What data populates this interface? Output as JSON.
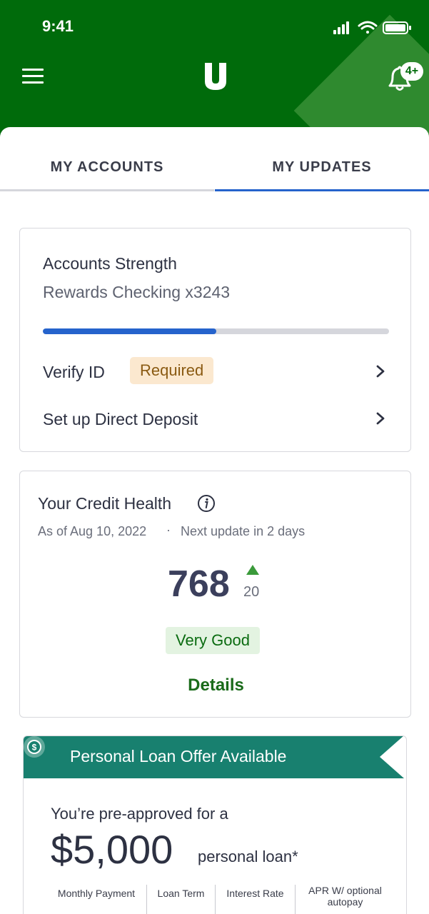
{
  "status_bar": {
    "time": "9:41"
  },
  "header": {
    "notification_badge": "4+"
  },
  "tabs": [
    {
      "label": "MY ACCOUNTS"
    },
    {
      "label": "MY UPDATES"
    }
  ],
  "accounts_strength": {
    "title": "Accounts Strength",
    "account": "Rewards Checking x3243",
    "progress_fraction": 0.5,
    "items": [
      {
        "label": "Verify ID",
        "badge": "Required"
      },
      {
        "label": "Set up Direct Deposit"
      }
    ]
  },
  "credit_health": {
    "title": "Your Credit Health",
    "as_of": "As of Aug 10, 2022",
    "separator": "·",
    "next_update": "Next update in 2 days",
    "score": "768",
    "change": "20",
    "rating": "Very Good",
    "details_label": "Details"
  },
  "loan_offer": {
    "banner": "Personal Loan Offer Available",
    "preapproved_text": "You’re pre-approved for a",
    "amount": "$5,000",
    "amount_suffix": "personal loan*",
    "terms": [
      {
        "label": "Monthly Payment"
      },
      {
        "label": "Loan Term"
      },
      {
        "label": "Interest Rate"
      },
      {
        "label": "APR W/ optional autopay"
      }
    ]
  },
  "colors": {
    "header_green": "#006b0b",
    "active_tab": "#2563cc",
    "banner_teal": "#18806f"
  }
}
